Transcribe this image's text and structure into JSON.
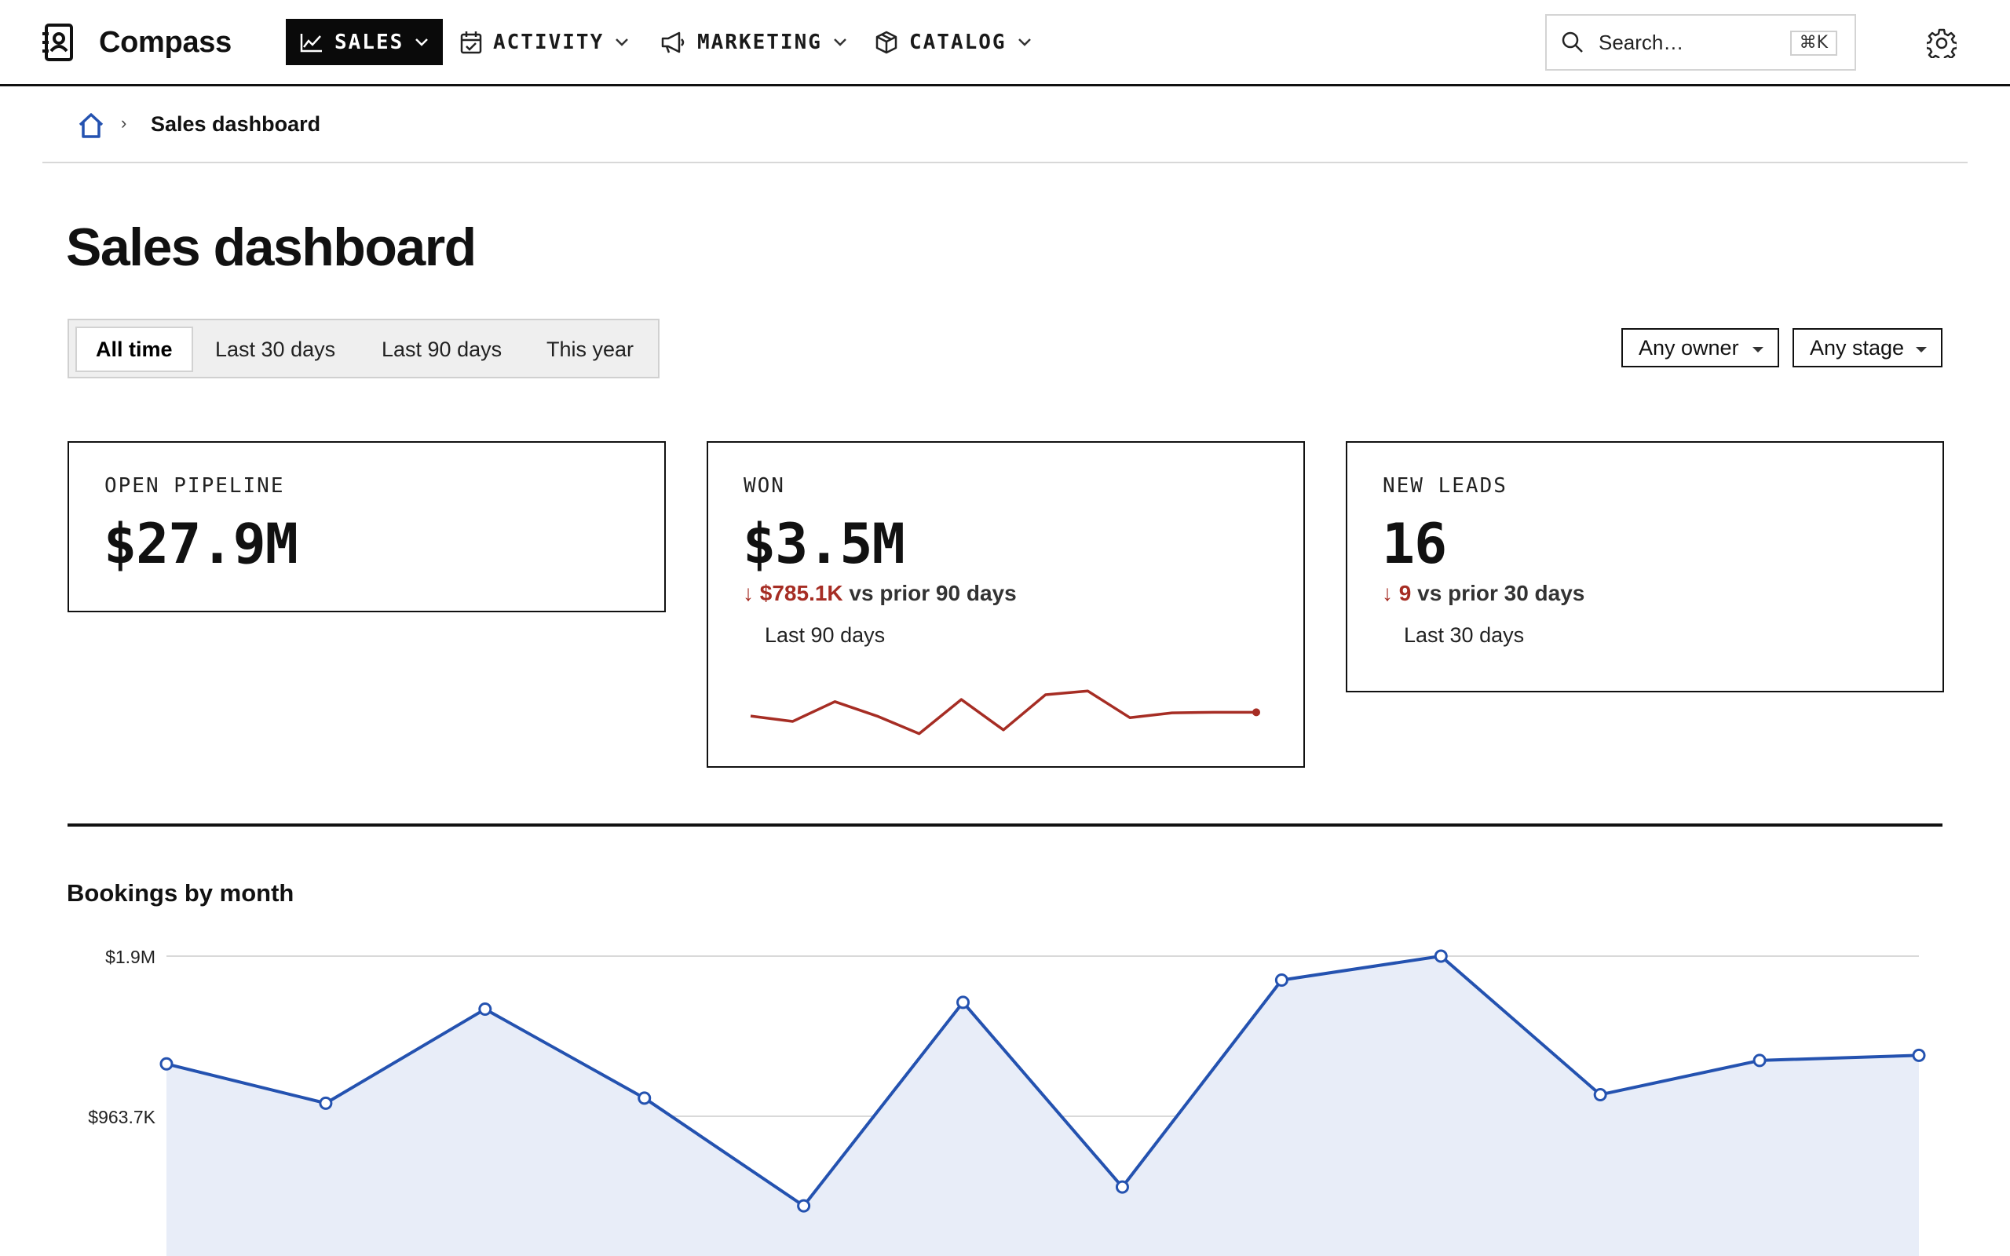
{
  "app": {
    "name": "Compass"
  },
  "nav": {
    "sales": "SALES",
    "activity": "ACTIVITY",
    "marketing": "MARKETING",
    "catalog": "CATALOG"
  },
  "search": {
    "placeholder": "Search…",
    "shortcut": "⌘K"
  },
  "breadcrumb": {
    "separator": "›",
    "current": "Sales dashboard"
  },
  "page": {
    "title": "Sales dashboard"
  },
  "range_tabs": [
    "All time",
    "Last 30 days",
    "Last 90 days",
    "This year"
  ],
  "range_selected": "All time",
  "filters": {
    "owner": "Any owner",
    "stage": "Any stage"
  },
  "kpis": {
    "open_pipeline": {
      "label": "OPEN PIPELINE",
      "value": "$27.9M"
    },
    "won": {
      "label": "WON",
      "value": "$3.5M",
      "delta_arrow": "↓",
      "delta_value": "$785.1K",
      "delta_text": " vs prior 90 days",
      "period": "Last 90 days",
      "sparkline": [
        0.38,
        0.28,
        0.65,
        0.38,
        0.05,
        0.69,
        0.12,
        0.78,
        0.85,
        0.35,
        0.44,
        0.45,
        0.45
      ]
    },
    "new_leads": {
      "label": "NEW LEADS",
      "value": "16",
      "delta_arrow": "↓",
      "delta_value": "9",
      "delta_text": " vs prior 30 days",
      "period": "Last 30 days"
    }
  },
  "colors": {
    "accent_blue": "#2452b0",
    "area_fill": "#e8edf8",
    "negative_red": "#a62d24",
    "nav_active_bg": "#0a0a0a"
  },
  "icons": {
    "brand": "contact-book-icon",
    "sales": "line-chart-icon",
    "activity": "calendar-check-icon",
    "marketing": "megaphone-icon",
    "catalog": "box-icon",
    "search": "search-icon",
    "settings": "gear-icon",
    "home": "home-icon"
  },
  "chart_data": {
    "type": "area",
    "title": "Bookings by month",
    "xlabel": "",
    "ylabel": "",
    "y_tick_labels": [
      "$1.9M",
      "$963.7K"
    ],
    "y_ticks": [
      1900000,
      963700
    ],
    "x": [
      1,
      2,
      3,
      4,
      5,
      6,
      7,
      8,
      9,
      10,
      11,
      12
    ],
    "values": [
      1270000,
      1040000,
      1590000,
      1070000,
      440000,
      1630000,
      550000,
      1760000,
      1900000,
      1090000,
      1290000,
      1320000
    ],
    "grid": true,
    "legend": "none"
  }
}
